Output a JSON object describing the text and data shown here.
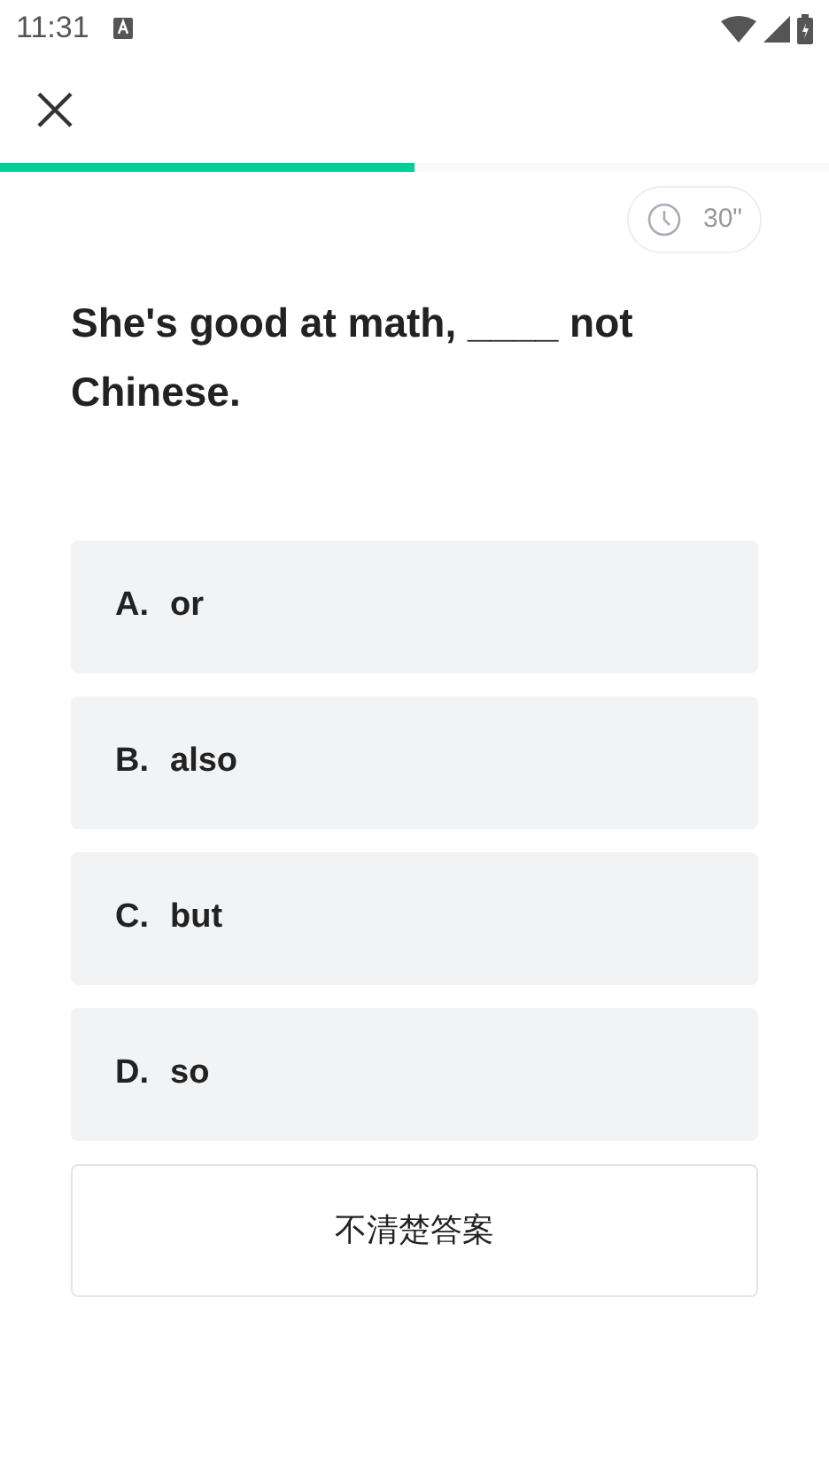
{
  "status_bar": {
    "time": "11:31"
  },
  "progress": {
    "level": 0.5
  },
  "timer": {
    "text": "30\""
  },
  "question": "She's good at math, ____ not Chinese.",
  "options": [
    {
      "letter": "A.",
      "text": "or",
      "selected": false
    },
    {
      "letter": "B.",
      "text": "also",
      "selected": false
    },
    {
      "letter": "C.",
      "text": "but",
      "selected": false
    },
    {
      "letter": "D.",
      "text": "so",
      "selected": false
    }
  ],
  "unsure_button": "不清楚答案"
}
